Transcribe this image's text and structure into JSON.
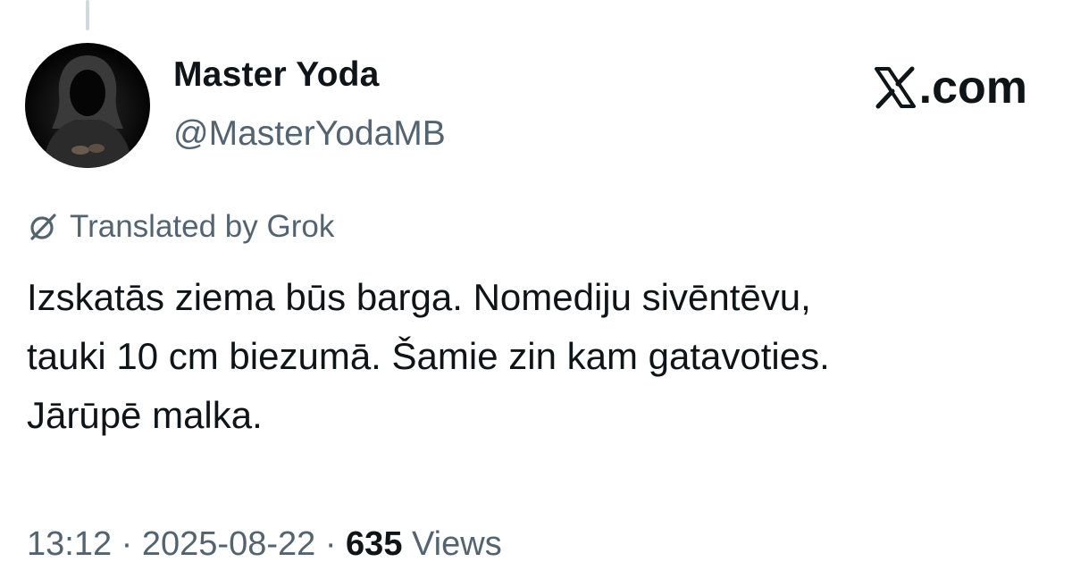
{
  "author": {
    "display_name": "Master Yoda",
    "handle": "@MasterYodaMB",
    "avatar_icon": "hooded-figure-avatar"
  },
  "brand": {
    "label": ".com",
    "icon": "x-logo-icon"
  },
  "translation": {
    "label": "Translated by Grok",
    "icon": "grok-icon"
  },
  "tweet": {
    "lines": [
      "Izskatās ziema būs barga. Nomediju sivēntēvu,",
      "tauki 10 cm biezumā. Šamie zin kam gatavoties.",
      "Jārūpē malka."
    ]
  },
  "meta": {
    "time": "13:12",
    "separator": " · ",
    "date": "2025-08-22",
    "views_count": "635",
    "views_label": " Views"
  },
  "colors": {
    "text_primary": "#0f1419",
    "text_secondary": "#536471",
    "thread_line": "#cfd9de"
  }
}
